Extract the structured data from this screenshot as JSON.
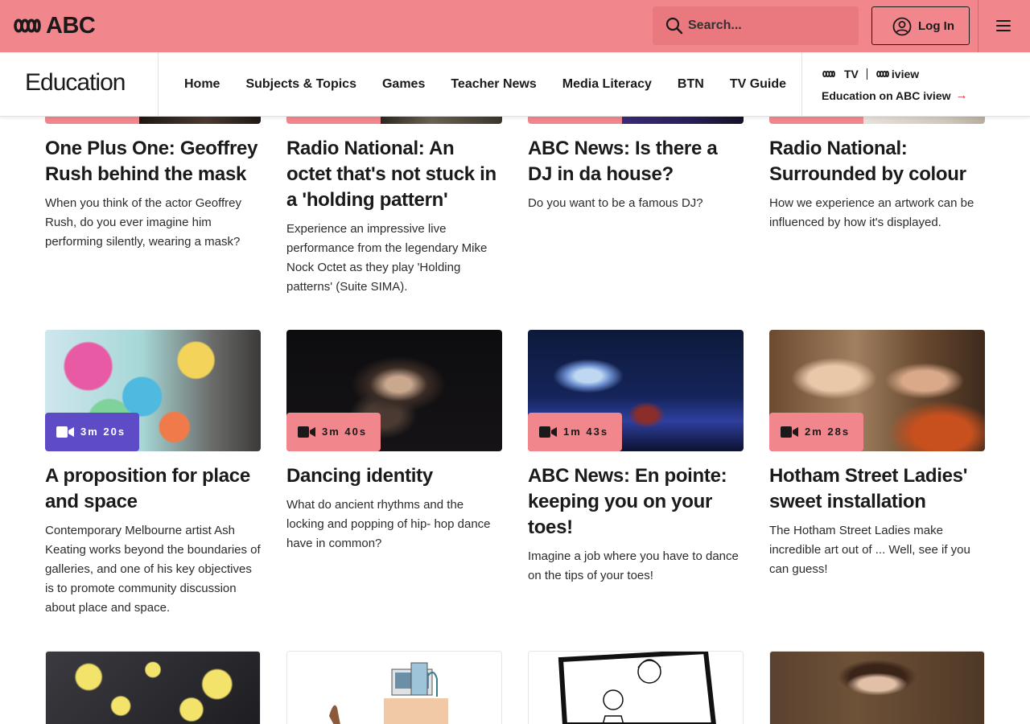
{
  "header": {
    "brand": "ABC",
    "search_placeholder": "Search...",
    "login_label": "Log In"
  },
  "section": {
    "title": "Education",
    "nav": [
      "Home",
      "Subjects & Topics",
      "Games",
      "Teacher News",
      "Media Literacy",
      "BTN",
      "TV Guide"
    ],
    "iview_brand_tv": "TV",
    "iview_brand_iview": "iview",
    "iview_link": "Education on ABC iview",
    "iview_arrow": "→"
  },
  "colors": {
    "topbar": "#f2868d",
    "badge_pink": "#f2868d",
    "badge_purple": "#5d4cc6",
    "search_bg": "#e9797f"
  },
  "icons": [
    "search-icon",
    "user-circle-icon",
    "hamburger-menu-icon",
    "video-camera-icon",
    "arrow-right-icon"
  ],
  "row1": [
    {
      "title": "One Plus One: Geoffrey Rush behind the mask",
      "desc": "When you think of the actor Geoffrey Rush, do you ever imagine him performing silently, wearing a mask?"
    },
    {
      "title": "Radio National: An octet that's not stuck in a 'holding pattern'",
      "desc": "Experience an impressive live performance from the legendary Mike Nock Octet as they play 'Holding patterns' (Suite SIMA)."
    },
    {
      "title": "ABC News: Is there a DJ in da house?",
      "desc": "Do you want to be a famous DJ?"
    },
    {
      "title": "Radio National: Surrounded by colour",
      "desc": "How we experience an artwork can be influenced by how it's displayed."
    }
  ],
  "row2": [
    {
      "duration": "3m 20s",
      "title": "A proposition for place and space",
      "desc": "Contemporary Melbourne artist Ash Keating works beyond the boundaries of galleries, and one of his key objectives is to promote community discussion about place and space."
    },
    {
      "duration": "3m 40s",
      "title": "Dancing identity",
      "desc": "What do ancient rhythms and the locking and popping of hip- hop dance have in common?"
    },
    {
      "duration": "1m 43s",
      "title": "ABC News: En pointe: keeping you on your toes!",
      "desc": "Imagine a job where you have to dance on the tips of your toes!"
    },
    {
      "duration": "2m 28s",
      "title": "Hotham Street Ladies' sweet installation",
      "desc": "The Hotham Street Ladies make incredible art out of ... Well, see if you can guess!"
    }
  ]
}
